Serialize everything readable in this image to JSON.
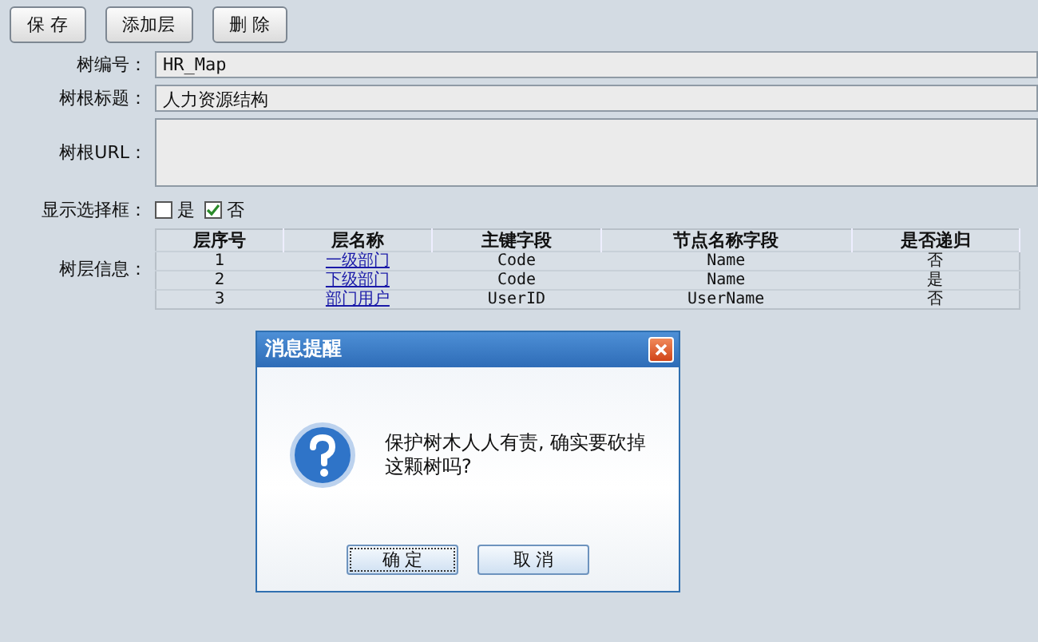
{
  "toolbar": {
    "buttons": [
      "保 存",
      "添加层",
      "删 除"
    ]
  },
  "fields": [
    {
      "kind": "input",
      "label": "树编号：",
      "value": "HR_Map"
    },
    {
      "kind": "input",
      "label": "树根标题：",
      "value": "人力资源结构"
    },
    {
      "kind": "textarea",
      "label": "树根URL："
    }
  ],
  "show_checkbox": {
    "label": "显示选择框：",
    "options": [
      {
        "label": "是",
        "checked": false
      },
      {
        "label": "否",
        "checked": true
      }
    ]
  },
  "tree_levels": {
    "label": "树层信息：",
    "columns": [
      "层序号",
      "层名称",
      "主键字段",
      "节点名称字段",
      "是否递归"
    ],
    "rows": [
      [
        "1",
        "一级部门",
        "Code",
        "Name",
        "否"
      ],
      [
        "2",
        "下级部门",
        "Code",
        "Name",
        "是"
      ],
      [
        "3",
        "部门用户",
        "UserID",
        "UserName",
        "否"
      ]
    ]
  },
  "dialog": {
    "title": "消息提醒",
    "message": "保护树木人人有责, 确实要砍掉这颗树吗?",
    "buttons": [
      {
        "label": "确 定",
        "focused": true
      },
      {
        "label": "取 消",
        "focused": false
      }
    ]
  }
}
